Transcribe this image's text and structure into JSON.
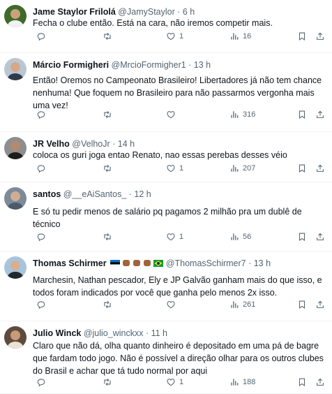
{
  "tweets": [
    {
      "name": "Jame Staylor Frilolá",
      "handle": "@JamyStaylor",
      "time": "6 h",
      "lines": [
        "Fecha o clube então. Está na cara, não iremos competir mais."
      ],
      "likes": "1",
      "views": "16",
      "avatar": {
        "bg": "#3e6b2c",
        "skin": "#c9a27c",
        "shirt": "#f2f2f2"
      }
    },
    {
      "name": "Márcio Formigheri",
      "handle": "@MrcioFormigher1",
      "time": "13 h",
      "lines": [
        "Então! Oremos no Campeonato Brasileiro! Libertadores já não tem chance",
        "nenhuma! Que foquem no Brasileiro para não passarmos vergonha mais",
        "uma vez!"
      ],
      "likes": "",
      "views": "316",
      "avatar": {
        "bg": "#b9c7d4",
        "skin": "#d6a98a",
        "shirt": "#2f3a4a"
      }
    },
    {
      "name": "JR Velho",
      "handle": "@VelhoJr",
      "time": "14 h",
      "lines": [
        "coloca os guri joga entao Renato, nao essas perebas desses véio"
      ],
      "likes": "1",
      "views": "207",
      "avatar": {
        "bg": "#8e8e8e",
        "skin": "#b48a6e",
        "shirt": "#1d1d1d"
      }
    },
    {
      "name": "santos",
      "handle": "@__eAiSantos_",
      "time": "12 h",
      "lines": [
        "E só tu pedir menos de salário pq pagamos 2 milhão pra um dublê de",
        "técnico"
      ],
      "likes": "1",
      "views": "56",
      "avatar": {
        "bg": "#7c8a99",
        "skin": "#cfae92",
        "shirt": "#4a5a6b"
      }
    },
    {
      "name": "Thomas Schirmer",
      "handle": "@ThomasSchirmer7",
      "time": "13 h",
      "lines": [
        "Marchesin, Nathan pescador, Ely e JP Galvão ganham mais do que isso, e",
        "todos foram indicados por você que ganha pelo menos 2x isso."
      ],
      "likes": "",
      "views": "261",
      "avatar": {
        "bg": "#a7c4dd",
        "skin": "#d8b08f",
        "shirt": "#202830"
      }
    },
    {
      "name": "Julio Winck",
      "handle": "@julio_winckxx",
      "time": "11 h",
      "lines": [
        "Claro que não dá, olha quanto dinheiro é depositado em uma pá de bagre",
        "que fardam todo jogo. Não é possível a direção olhar para os outros clubes",
        "do Brasil e achar que tá tudo normal por aqui"
      ],
      "likes": "1",
      "views": "188",
      "avatar": {
        "bg": "#5f4b3e",
        "skin": "#c89a78",
        "shirt": "#e9e2d5"
      }
    }
  ],
  "colors": {
    "muted": "#536471",
    "text": "#0f1419",
    "divider": "#eff3f4"
  },
  "icons": [
    "reply-icon",
    "retweet-icon",
    "like-icon",
    "views-icon",
    "bookmark-icon",
    "share-icon"
  ],
  "flags": [
    "estonia-flag-icon",
    "raised-fist-icon",
    "raised-fist-icon",
    "raised-fist-icon",
    "brazil-flag-icon"
  ]
}
